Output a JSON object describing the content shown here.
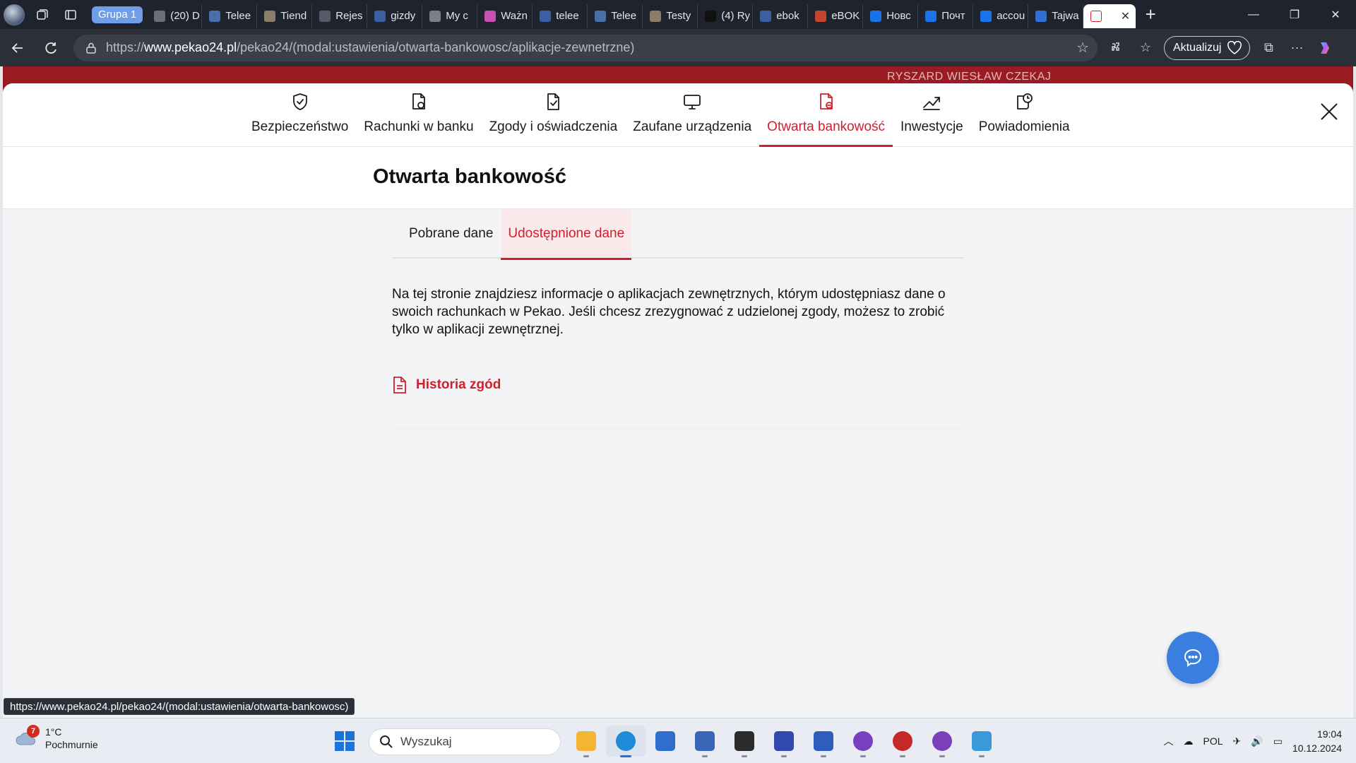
{
  "browser": {
    "group_label": "Grupa 1",
    "tabs": [
      {
        "title": "(20) D",
        "color": "#6b6f78"
      },
      {
        "title": "Telee",
        "color": "#4a6ea8"
      },
      {
        "title": "Tiend",
        "color": "#8a7d6b"
      },
      {
        "title": "Rejes",
        "color": "#555b66"
      },
      {
        "title": "gizdy",
        "color": "#3b5fa0"
      },
      {
        "title": "My c",
        "color": "#7a7f88"
      },
      {
        "title": "Ważn",
        "color": "#c94fb0"
      },
      {
        "title": "telee",
        "color": "#3b5fa0"
      },
      {
        "title": "Telee",
        "color": "#4a6ea8"
      },
      {
        "title": "Testy",
        "color": "#8a7d6b"
      },
      {
        "title": "(4) Ry",
        "color": "#111111"
      },
      {
        "title": "ebok",
        "color": "#3b5fa0"
      },
      {
        "title": "eBOK",
        "color": "#c2452f"
      },
      {
        "title": "Новс",
        "color": "#1a73e8"
      },
      {
        "title": "Почт",
        "color": "#1a73e8"
      },
      {
        "title": "accou",
        "color": "#1a73e8"
      },
      {
        "title": "Tajwa",
        "color": "#2f6fd6"
      }
    ],
    "active_tab": {
      "title": "",
      "color": "#d0202e"
    },
    "new_tab_icon": "plus-icon",
    "address": {
      "prefix": "https://",
      "host": "www.pekao24.pl",
      "path": "/pekao24/(modal:ustawienia/otwarta-bankowosc/aplikacje-zewnetrzne)"
    },
    "update_label": "Aktualizuj",
    "status_url": "https://www.pekao24.pl/pekao24/(modal:ustawienia/otwarta-bankowosc)"
  },
  "bank": {
    "user_name": "RYSZARD WIESŁAW CZEKAJ"
  },
  "settings": {
    "nav": [
      {
        "label": "Bezpieczeństwo",
        "icon": "shield-check-icon",
        "active": false
      },
      {
        "label": "Rachunki w banku",
        "icon": "document-link-icon",
        "active": false
      },
      {
        "label": "Zgody i oświadczenia",
        "icon": "document-check-icon",
        "active": false
      },
      {
        "label": "Zaufane urządzenia",
        "icon": "monitor-icon",
        "active": false
      },
      {
        "label": "Otwarta bankowość",
        "icon": "document-share-icon",
        "active": true
      },
      {
        "label": "Inwestycje",
        "icon": "trend-up-icon",
        "active": false
      },
      {
        "label": "Powiadomienia",
        "icon": "bell-clock-icon",
        "active": false
      }
    ],
    "page_title": "Otwarta bankowość",
    "sub_tabs": [
      {
        "label": "Pobrane dane",
        "active": false
      },
      {
        "label": "Udostępnione dane",
        "active": true
      }
    ],
    "info_text": "Na tej stronie znajdziesz informacje o aplikacjach zewnętrznych, którym udostępniasz dane o swoich rachunkach w Pekao. Jeśli chcesz zrezygnować z udzielonej zgody, możesz to zrobić tylko w aplikacji zewnętrznej.",
    "history_link": "Historia zgód",
    "accent_color": "#d0202e",
    "chat_color": "#3a7ee0"
  },
  "taskbar": {
    "weather_temp": "1°C",
    "weather_desc": "Pochmurnie",
    "weather_badge": "7",
    "search_placeholder": "Wyszukaj",
    "apps": [
      {
        "name": "file-explorer-icon",
        "color": "#f2b632",
        "running": true
      },
      {
        "name": "edge-icon",
        "color": "#1f8ad8",
        "running": true,
        "focused": true
      },
      {
        "name": "store-icon",
        "color": "#2f6ecf",
        "running": false
      },
      {
        "name": "network-app-icon",
        "color": "#3c67b8",
        "running": true
      },
      {
        "name": "terminal-icon",
        "color": "#2b2b2b",
        "running": true
      },
      {
        "name": "save-app-icon",
        "color": "#3048b0",
        "running": true
      },
      {
        "name": "app-a-icon",
        "color": "#2d5dbd",
        "running": true
      },
      {
        "name": "tor-icon",
        "color": "#7a3fc0",
        "running": true
      },
      {
        "name": "red-app-icon",
        "color": "#c62828",
        "running": true
      },
      {
        "name": "github-icon",
        "color": "#7b3fb8",
        "running": true
      },
      {
        "name": "notepad-icon",
        "color": "#3a9ad9",
        "running": true
      }
    ],
    "language": "POL",
    "time": "19:04",
    "date": "10.12.2024"
  }
}
